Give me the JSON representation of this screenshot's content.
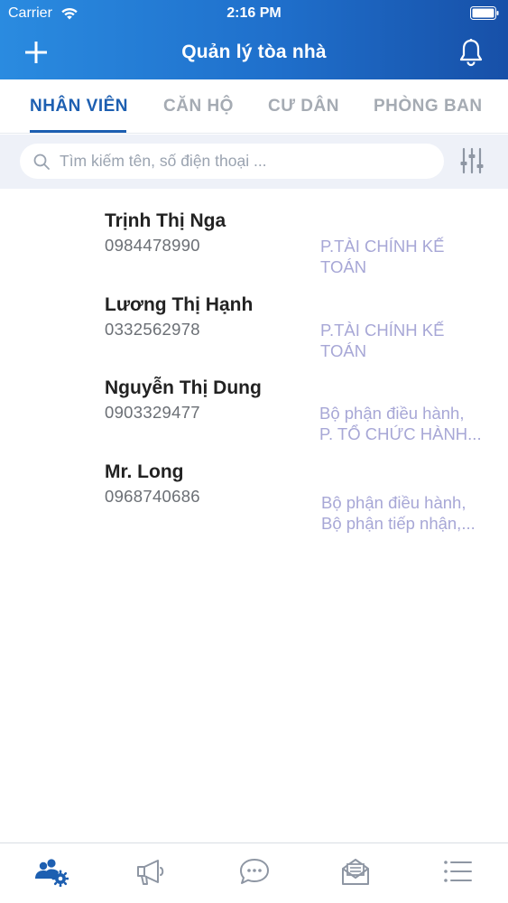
{
  "status": {
    "carrier": "Carrier",
    "time": "2:16 PM"
  },
  "header": {
    "title": "Quản lý tòa nhà"
  },
  "tabs": [
    {
      "label": "NHÂN VIÊN",
      "active": true
    },
    {
      "label": "CĂN HỘ",
      "active": false
    },
    {
      "label": "CƯ DÂN",
      "active": false
    },
    {
      "label": "PHÒNG BAN",
      "active": false
    }
  ],
  "search": {
    "placeholder": "Tìm kiếm tên, số điện thoại ..."
  },
  "employees": [
    {
      "name": "Trịnh Thị Nga",
      "phone": "0984478990",
      "dept_line1": "P.TÀI CHÍNH KẾ",
      "dept_line2": "TOÁN"
    },
    {
      "name": "Lương Thị Hạnh",
      "phone": "0332562978",
      "dept_line1": "P.TÀI CHÍNH KẾ",
      "dept_line2": "TOÁN"
    },
    {
      "name": "Nguyễn Thị Dung",
      "phone": "0903329477",
      "dept_line1": "Bộ phận điều hành,",
      "dept_line2": "P. TỔ CHỨC HÀNH..."
    },
    {
      "name": "Mr. Long",
      "phone": "0968740686",
      "dept_line1": "Bộ phận điều hành,",
      "dept_line2": "Bộ phận tiếp nhận,..."
    }
  ],
  "bottom_tabs": [
    {
      "icon": "staff-settings-icon",
      "active": true
    },
    {
      "icon": "megaphone-icon",
      "active": false
    },
    {
      "icon": "chat-bubble-icon",
      "active": false
    },
    {
      "icon": "mail-icon",
      "active": false
    },
    {
      "icon": "menu-list-icon",
      "active": false
    }
  ],
  "colors": {
    "accent": "#1d5fb1",
    "header_start": "#2a8be0",
    "header_end": "#1750a8",
    "dept_text": "#a7a7d6",
    "inactive_icon": "#8e96a3"
  }
}
